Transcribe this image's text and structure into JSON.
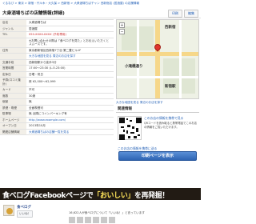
{
  "breadcrumb": "ぐるなび > 東京 > 新宿・代々木・大久保 > 西新宿 > 大衆酒場ちばチャン 西新宿店 (居酒屋) の店舗情報",
  "page_title": "大衆酒場ちばの店舗情報(詳細)",
  "header_buttons": {
    "print": "印刷",
    "edit": "編集"
  },
  "info_rows": [
    {
      "key": "店名",
      "value": "大衆酒場ちば",
      "style": ""
    },
    {
      "key": "ジャンル",
      "value": "居酒屋",
      "style": ""
    },
    {
      "key": "TEL",
      "value": "050-XXXX-XXXX (予約専用)",
      "style": "red"
    },
    {
      "key": "",
      "value": "※お問い合わせの際は「食べログを見た」とお伝えいただくとスムーズです。",
      "style": ""
    },
    {
      "key": "住所",
      "value": "東京都新宿区西新宿7丁目 第二豊ビル1F",
      "style": ""
    },
    {
      "key": "",
      "value": "大きな地図を見る 周辺のお店を探す",
      "style": "link"
    },
    {
      "key": "交通手段",
      "value": "西新宿駅から徒歩3分",
      "style": ""
    },
    {
      "key": "営業時間",
      "value": "17:00〜23:30 (L.O.23:00)",
      "style": ""
    },
    {
      "key": "定休日",
      "value": "日曜・祝日",
      "style": ""
    },
    {
      "key": "予算(口コミ集計)",
      "value": "夜 ¥2,000〜¥2,999",
      "style": ""
    },
    {
      "key": "カード",
      "value": "不可",
      "style": ""
    },
    {
      "key": "席数",
      "value": "30席",
      "style": ""
    },
    {
      "key": "個室",
      "value": "無",
      "style": ""
    },
    {
      "key": "禁煙・喫煙",
      "value": "全面喫煙可",
      "style": ""
    },
    {
      "key": "駐車場",
      "value": "無 近隣にコインパーキング有",
      "style": ""
    },
    {
      "key": "ホームページ",
      "value": "http://www.example.com/",
      "style": "link"
    },
    {
      "key": "オープン日",
      "value": "2013年10月",
      "style": ""
    },
    {
      "key": "関連店舗情報",
      "value": "大衆酒場ちばの店舗一覧を見る",
      "style": "link"
    }
  ],
  "map": {
    "labels": [
      "西新宿",
      "小滝橋通り",
      "新宿駅"
    ],
    "zoom_in": "+",
    "zoom_out": "−"
  },
  "map_links": "大きな地図を見る  周辺のお店を探す",
  "side": {
    "heading": "関連情報",
    "qr_title": "このお店の情報を携帯で見る",
    "qr_desc": "QRコードを読み取ると携帯電話でこのお店の情報をご覧いただけます。",
    "send_link": "このお店の情報を携帯に送る",
    "print_button": "印刷ページを表示"
  },
  "banner": {
    "prefix": "食べログ",
    "middle": "Facebookページで",
    "highlight": "「おいしい」",
    "suffix": "を再発掘！"
  },
  "facebook": {
    "page_name": "食べログ",
    "like_label": "いいね！",
    "count_text": "16,622人が食べログについて「いいね！」と言っています"
  }
}
